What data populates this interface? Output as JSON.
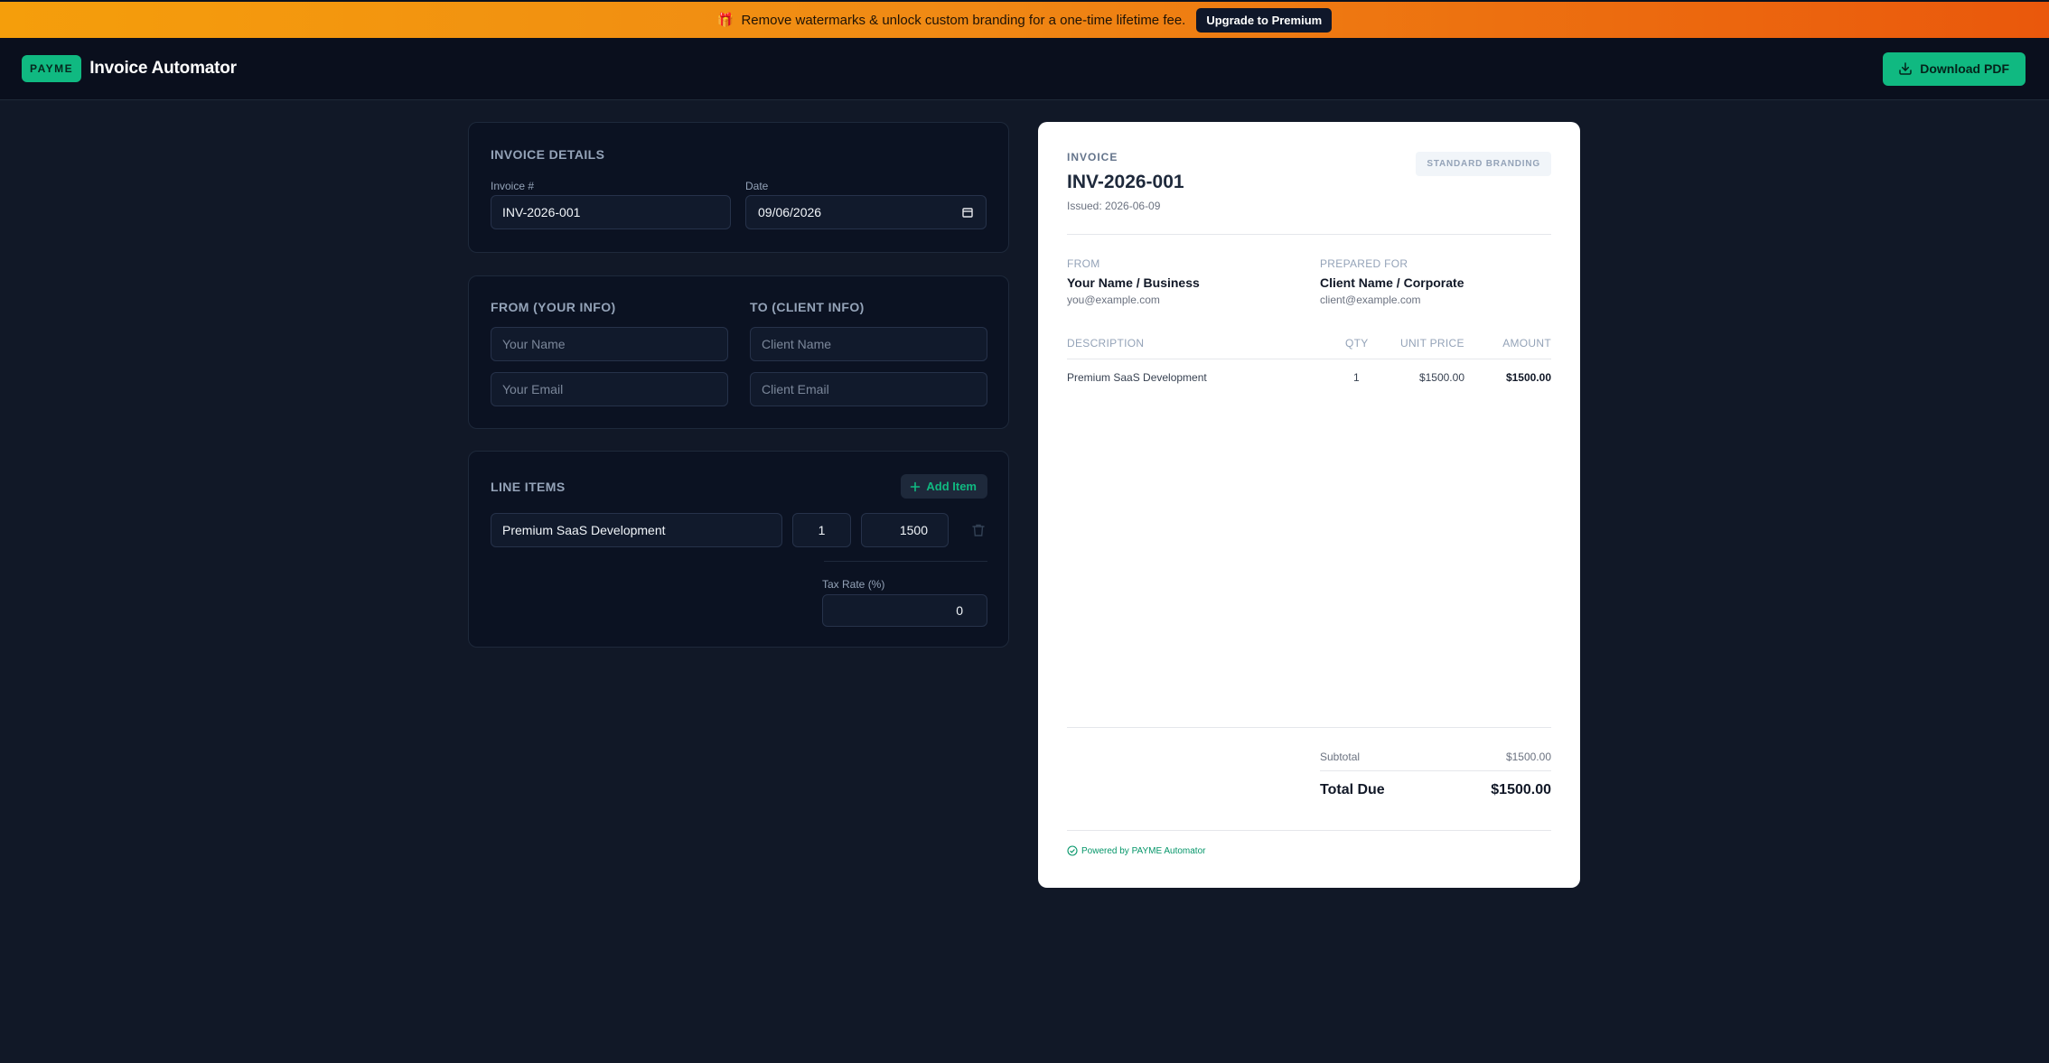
{
  "banner": {
    "icon": "gift-icon",
    "text": "Remove watermarks & unlock custom branding for a one-time lifetime fee.",
    "cta_label": "Upgrade to Premium"
  },
  "header": {
    "logo_text": "PAYME",
    "app_title": "Invoice Automator",
    "download_label": "Download PDF"
  },
  "invoice_details": {
    "title": "Invoice Details",
    "number_label": "Invoice #",
    "number_value": "INV-2026-001",
    "date_label": "Date",
    "date_value": "09/06/2026"
  },
  "parties": {
    "from_title": "From (Your Info)",
    "to_title": "To (Client Info)",
    "your_name_placeholder": "Your Name",
    "your_email_placeholder": "Your Email",
    "client_name_placeholder": "Client Name",
    "client_email_placeholder": "Client Email"
  },
  "line_items": {
    "title": "Line Items",
    "add_label": "Add Item",
    "items": [
      {
        "description": "Premium SaaS Development",
        "qty": "1",
        "price": "1500"
      }
    ],
    "tax_label": "Tax Rate (%)",
    "tax_value": "0"
  },
  "preview": {
    "label": "Invoice",
    "number": "INV-2026-001",
    "issued": "Issued: 2026-06-09",
    "badge": "Standard Branding",
    "from_label": "From",
    "from_name": "Your Name / Business",
    "from_email": "you@example.com",
    "to_label": "Prepared For",
    "to_name": "Client Name / Corporate",
    "to_email": "client@example.com",
    "columns": [
      "Description",
      "Qty",
      "Unit Price",
      "Amount"
    ],
    "rows": [
      {
        "description": "Premium SaaS Development",
        "qty": "1",
        "unit_price": "$1500.00",
        "amount": "$1500.00"
      }
    ],
    "subtotal_label": "Subtotal",
    "subtotal_value": "$1500.00",
    "total_label": "Total Due",
    "total_value": "$1500.00",
    "powered_by": "Powered by PAYME Automator"
  },
  "colors": {
    "accent": "#10b981",
    "banner_start": "#f59e0b",
    "banner_end": "#ea580c",
    "page_bg": "#111827"
  }
}
